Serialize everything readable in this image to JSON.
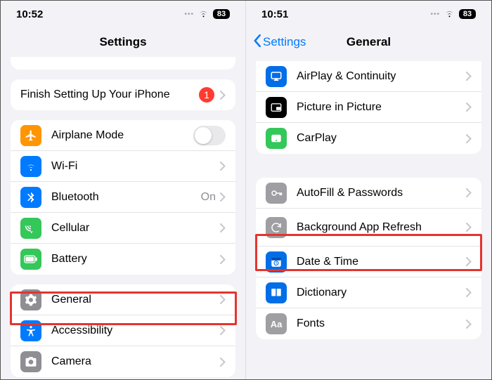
{
  "left": {
    "status": {
      "time": "10:52",
      "battery": "83"
    },
    "nav": {
      "title": "Settings"
    },
    "setup": {
      "label": "Finish Setting Up Your iPhone",
      "badge": "1"
    },
    "rows1": {
      "airplane": "Airplane Mode",
      "wifi": "Wi-Fi",
      "bluetooth": "Bluetooth",
      "bluetooth_value": "On",
      "cellular": "Cellular",
      "battery": "Battery"
    },
    "rows2": {
      "general": "General",
      "accessibility": "Accessibility",
      "camera": "Camera"
    }
  },
  "right": {
    "status": {
      "time": "10:51",
      "battery": "83"
    },
    "nav": {
      "back": "Settings",
      "title": "General"
    },
    "rows1": {
      "airplay": "AirPlay & Continuity",
      "pip": "Picture in Picture",
      "carplay": "CarPlay"
    },
    "rows2": {
      "autofill": "AutoFill & Passwords",
      "bgrefresh": "Background App Refresh",
      "datetime": "Date & Time",
      "dictionary": "Dictionary",
      "fonts": "Fonts"
    }
  }
}
